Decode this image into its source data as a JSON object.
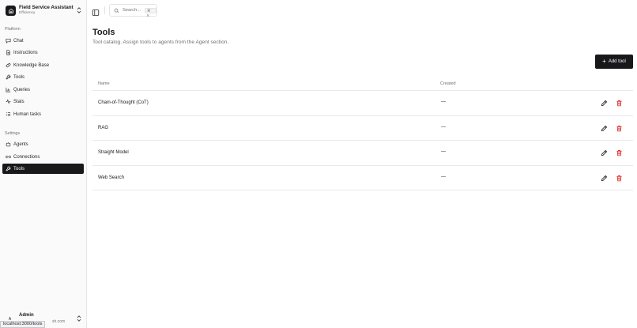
{
  "org": {
    "name": "Field Service Assistant",
    "subtitle": "Efficiency"
  },
  "sidebar": {
    "platform_label": "Platform",
    "platform_items": [
      {
        "label": "Chat",
        "icon": "chat-icon"
      },
      {
        "label": "Instructions",
        "icon": "document-icon"
      },
      {
        "label": "Knowledge Base",
        "icon": "link-icon"
      },
      {
        "label": "Tools",
        "icon": "wrench-icon"
      },
      {
        "label": "Queries",
        "icon": "chart-icon"
      },
      {
        "label": "Stats",
        "icon": "activity-icon"
      },
      {
        "label": "Human tasks",
        "icon": "list-icon"
      }
    ],
    "settings_label": "Settings",
    "settings_items": [
      {
        "label": "Agents",
        "icon": "bot-icon"
      },
      {
        "label": "Connections",
        "icon": "link-icon"
      },
      {
        "label": "Tools",
        "icon": "wrench-icon",
        "active": true
      }
    ]
  },
  "user": {
    "initial": "A",
    "name": "Admin",
    "email_visible": "sh.com"
  },
  "status_url": "localhost:3000/tools",
  "search": {
    "placeholder": "Search...",
    "shortcut": "⌘ K"
  },
  "page": {
    "title": "Tools",
    "subtitle": "Tool catalog. Assign tools to agents from the Agent section.",
    "add_button": "Add tool"
  },
  "table": {
    "columns": [
      "Name",
      "Created"
    ],
    "rows": [
      {
        "name": "Chain-of-Thought (CoT)",
        "created": "—"
      },
      {
        "name": "RAG",
        "created": "—"
      },
      {
        "name": "Straight Model",
        "created": "—"
      },
      {
        "name": "Web Search",
        "created": "—"
      }
    ]
  },
  "colors": {
    "primary": "#18181b",
    "muted": "#71717a",
    "danger": "#dc2626",
    "sidebar_bg": "#fafafa"
  }
}
